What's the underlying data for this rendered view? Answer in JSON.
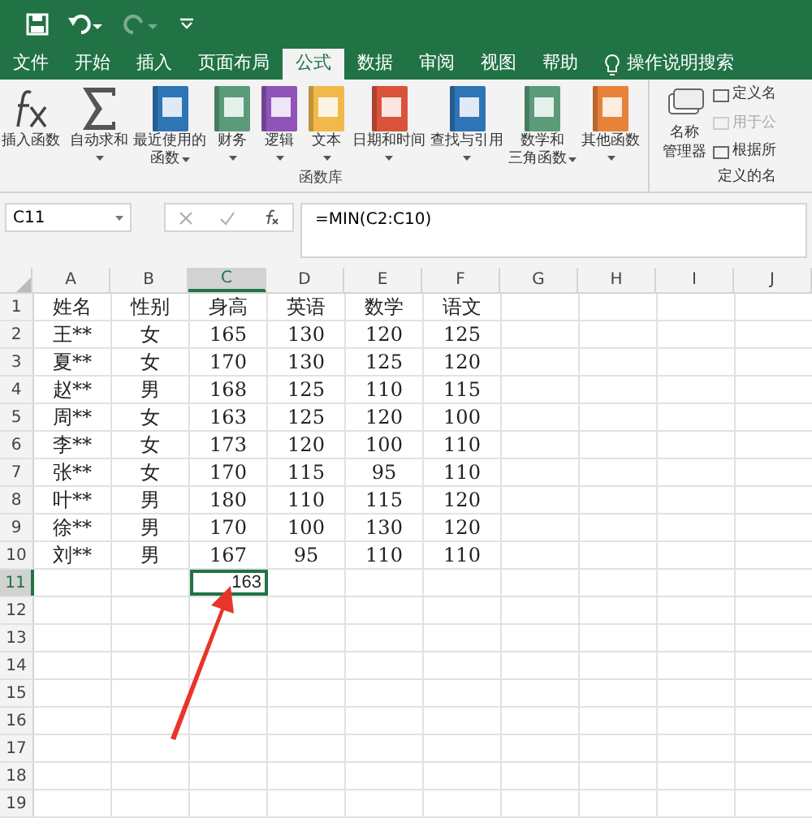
{
  "quick_access": {
    "redo_disabled": true
  },
  "tabs": [
    {
      "label": "文件",
      "selected": false
    },
    {
      "label": "开始",
      "selected": false
    },
    {
      "label": "插入",
      "selected": false
    },
    {
      "label": "页面布局",
      "selected": false
    },
    {
      "label": "公式",
      "selected": true
    },
    {
      "label": "数据",
      "selected": false
    },
    {
      "label": "审阅",
      "selected": false
    },
    {
      "label": "视图",
      "selected": false
    },
    {
      "label": "帮助",
      "selected": false
    }
  ],
  "tell_me": {
    "label": "操作说明搜索"
  },
  "ribbon": {
    "function_library": {
      "title": "函数库",
      "buttons": [
        {
          "kind": "fx",
          "lines": [
            "插入函数"
          ],
          "dropdown": false
        },
        {
          "kind": "sum",
          "lines": [
            "自动求和"
          ],
          "dropdown": true
        },
        {
          "kind": "book",
          "color": "#2e75b6",
          "lines": [
            "最近使用的",
            "函数"
          ],
          "dropdown": true
        },
        {
          "kind": "book",
          "color": "#5b9b7a",
          "lines": [
            "财务"
          ],
          "dropdown": true
        },
        {
          "kind": "book",
          "color": "#8e54b8",
          "lines": [
            "逻辑"
          ],
          "dropdown": true
        },
        {
          "kind": "book",
          "color": "#f0b94a",
          "lines": [
            "文本"
          ],
          "dropdown": true
        },
        {
          "kind": "book",
          "color": "#d9533b",
          "lines": [
            "日期和时间"
          ],
          "dropdown": true
        },
        {
          "kind": "book",
          "color": "#2e75b6",
          "lines": [
            "查找与引用"
          ],
          "dropdown": true
        },
        {
          "kind": "book",
          "color": "#5b9b7a",
          "lines": [
            "数学和",
            "三角函数"
          ],
          "dropdown": true
        },
        {
          "kind": "book",
          "color": "#e6823a",
          "lines": [
            "其他函数"
          ],
          "dropdown": true
        }
      ]
    },
    "defined_names": {
      "title": "定义的名",
      "manager": [
        "名称",
        "管理器"
      ],
      "items": [
        {
          "label": "定义名",
          "disabled": false
        },
        {
          "label": "用于公",
          "disabled": true
        },
        {
          "label": "根据所",
          "disabled": false
        }
      ]
    }
  },
  "name_box": "C11",
  "formula": "=MIN(C2:C10)",
  "columns": [
    {
      "label": "A",
      "selected": false
    },
    {
      "label": "B",
      "selected": false
    },
    {
      "label": "C",
      "selected": true
    },
    {
      "label": "D",
      "selected": false
    },
    {
      "label": "E",
      "selected": false
    },
    {
      "label": "F",
      "selected": false
    },
    {
      "label": "G",
      "selected": false
    },
    {
      "label": "H",
      "selected": false
    },
    {
      "label": "I",
      "selected": false
    },
    {
      "label": "J",
      "selected": false
    }
  ],
  "rows": [
    {
      "header": "1",
      "cells": [
        "姓名",
        "性别",
        "身高",
        "英语",
        "数学",
        "语文"
      ]
    },
    {
      "header": "2",
      "cells": [
        "王**",
        "女",
        "165",
        "130",
        "120",
        "125"
      ]
    },
    {
      "header": "3",
      "cells": [
        "夏**",
        "女",
        "170",
        "130",
        "125",
        "120"
      ]
    },
    {
      "header": "4",
      "cells": [
        "赵**",
        "男",
        "168",
        "125",
        "110",
        "115"
      ]
    },
    {
      "header": "5",
      "cells": [
        "周**",
        "女",
        "163",
        "125",
        "120",
        "100"
      ]
    },
    {
      "header": "6",
      "cells": [
        "李**",
        "女",
        "173",
        "120",
        "100",
        "110"
      ]
    },
    {
      "header": "7",
      "cells": [
        "张**",
        "女",
        "170",
        "115",
        "95",
        "110"
      ]
    },
    {
      "header": "8",
      "cells": [
        "叶**",
        "男",
        "180",
        "110",
        "115",
        "120"
      ]
    },
    {
      "header": "9",
      "cells": [
        "徐**",
        "男",
        "170",
        "100",
        "130",
        "120"
      ]
    },
    {
      "header": "10",
      "cells": [
        "刘**",
        "男",
        "167",
        "95",
        "110",
        "110"
      ]
    },
    {
      "header": "11",
      "selected": true,
      "active_value": "163"
    },
    {
      "header": "12",
      "selected": false
    },
    {
      "header": "13",
      "selected": false
    },
    {
      "header": "14",
      "selected": false
    },
    {
      "header": "15",
      "selected": false
    },
    {
      "header": "16",
      "selected": false
    },
    {
      "header": "17",
      "selected": false
    },
    {
      "header": "18",
      "selected": false
    },
    {
      "header": "19",
      "selected": false
    }
  ]
}
